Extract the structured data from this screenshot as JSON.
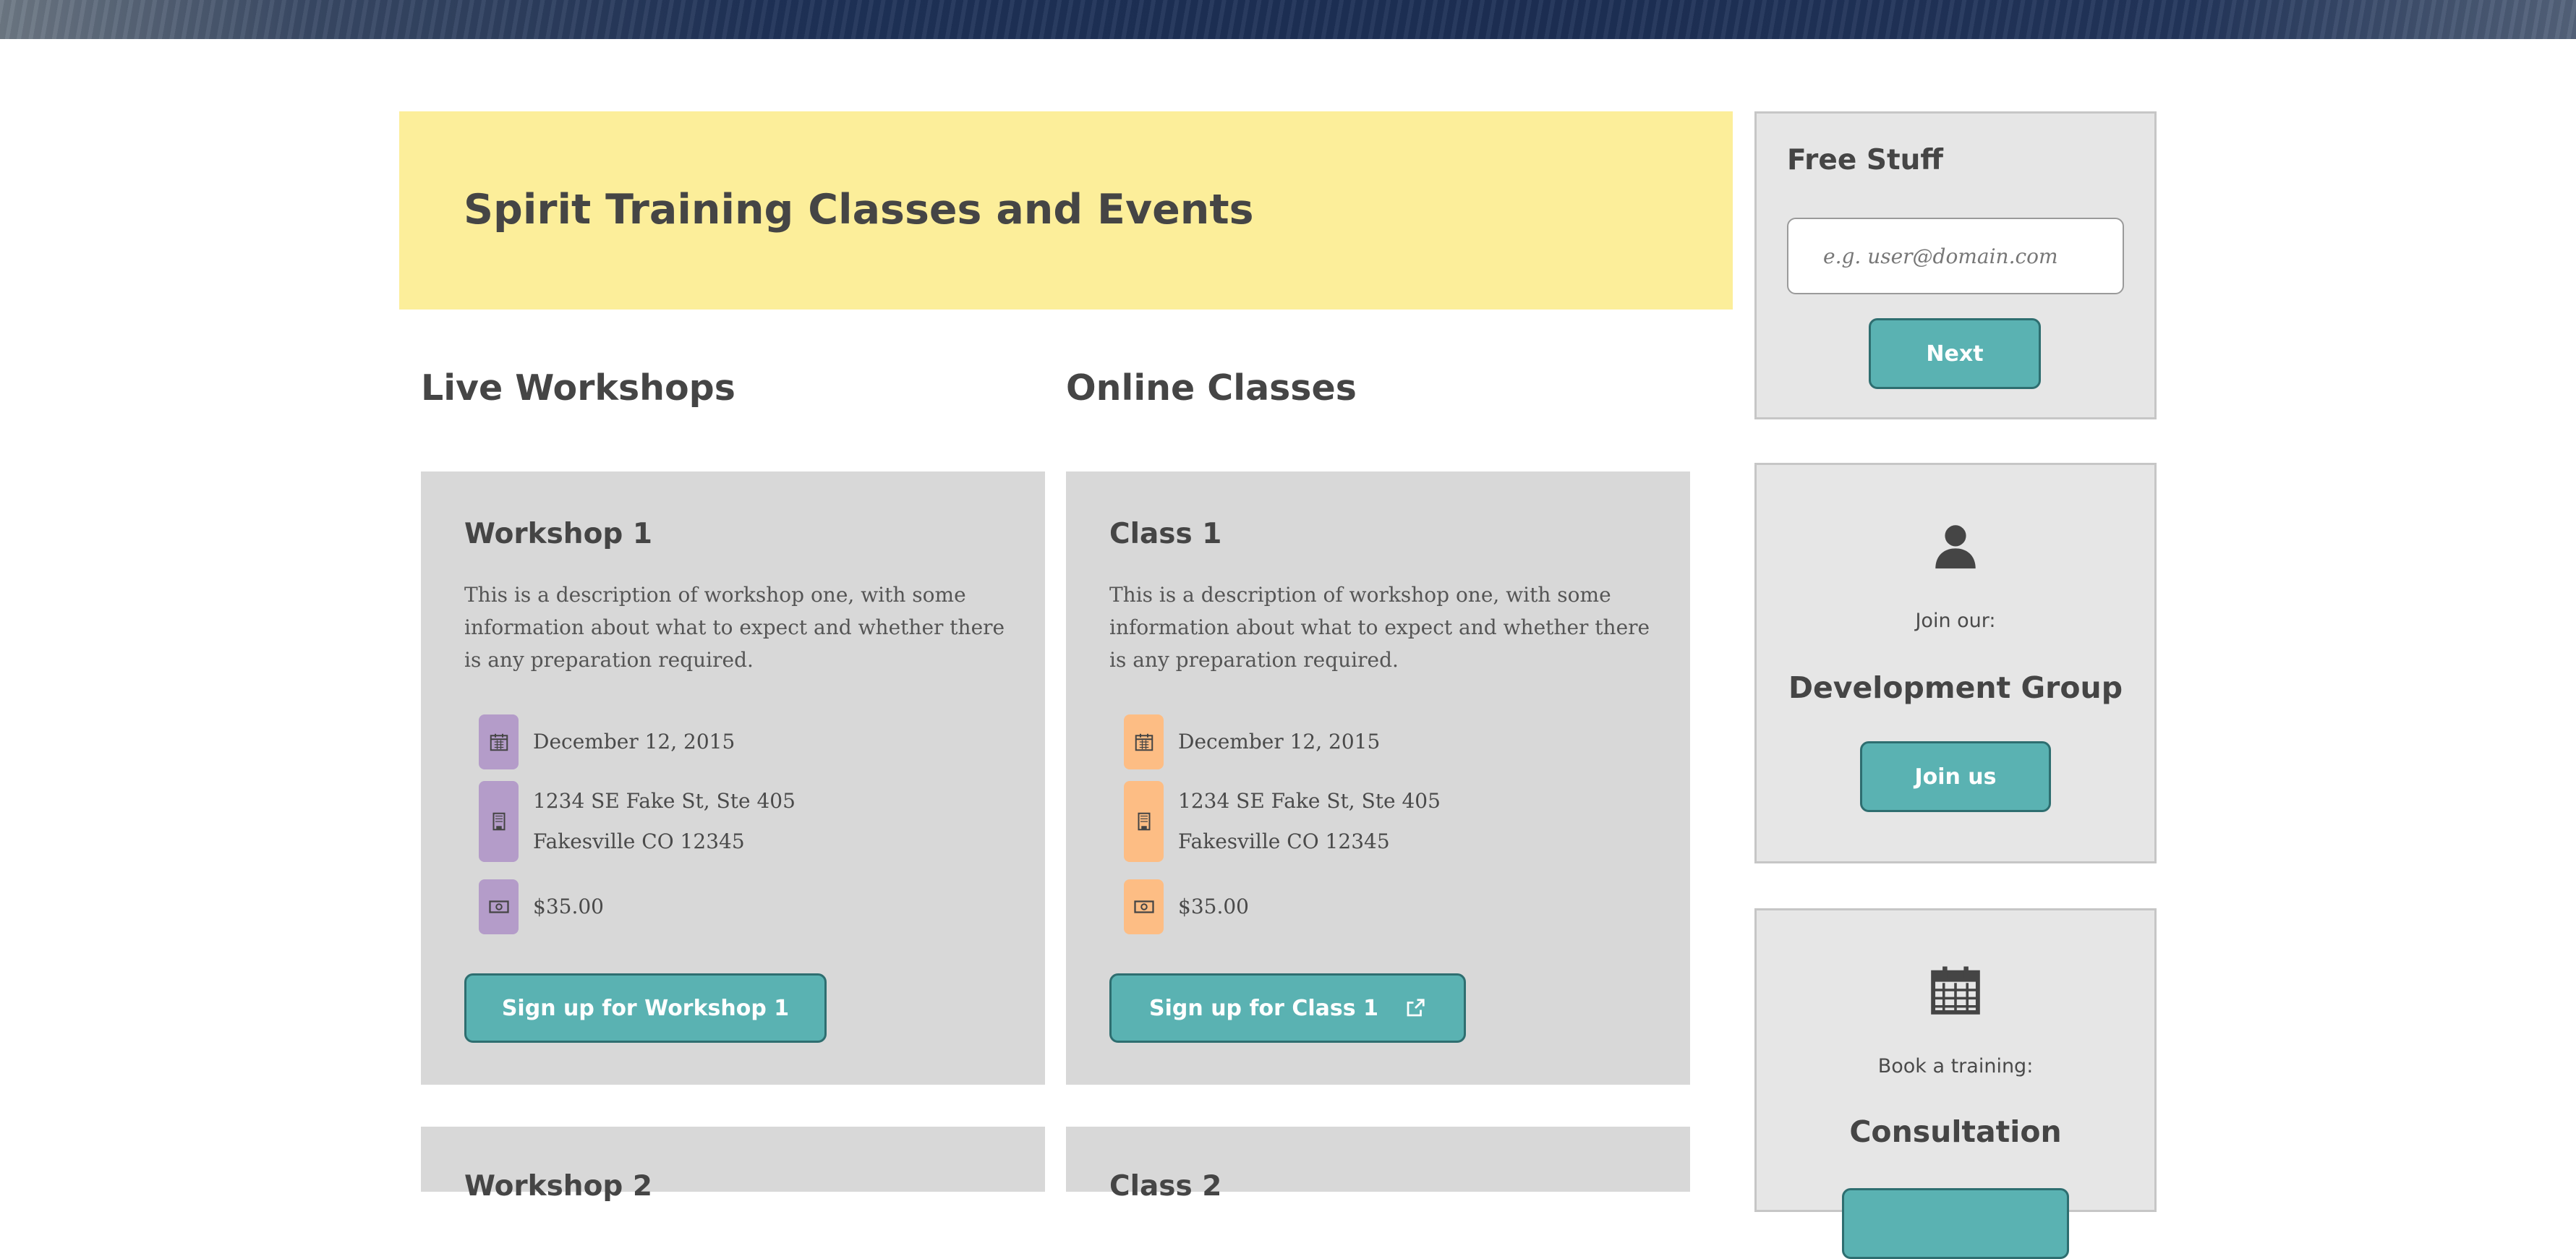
{
  "page": {
    "title": "Spirit Training Classes and Events"
  },
  "columns": {
    "workshops_heading": "Live Workshops",
    "classes_heading": "Online Classes"
  },
  "workshops": [
    {
      "title": "Workshop 1",
      "description": "This is a description of workshop one, with some information about what to expect and whether there is any preparation required.",
      "date": "December 12, 2015",
      "address_line1": "1234 SE Fake St, Ste 405",
      "address_line2": "Fakesville CO 12345",
      "price": "$35.00",
      "cta_label": "Sign up for Workshop 1"
    },
    {
      "title": "Workshop 2"
    }
  ],
  "classes": [
    {
      "title": "Class 1",
      "description": "This is a description of workshop one, with some information about what to expect and whether there is any preparation required.",
      "date": "December 12, 2015",
      "address_line1": "1234 SE Fake St, Ste 405",
      "address_line2": "Fakesville CO 12345",
      "price": "$35.00",
      "cta_label": "Sign up for Class 1"
    },
    {
      "title": "Class 2"
    }
  ],
  "sidebar": {
    "free_stuff": {
      "title": "Free Stuff",
      "email_placeholder": "e.g. user@domain.com",
      "next_label": "Next"
    },
    "group": {
      "icon": "user-icon",
      "intro": "Join our:",
      "name": "Development Group",
      "button_label": "Join us"
    },
    "consultation": {
      "icon": "calendar-icon",
      "intro": "Book a training:",
      "name": "Consultation"
    }
  },
  "colors": {
    "banner": "#fcee9a",
    "card": "#d8d8d8",
    "button": "#5ab2b2",
    "button_border": "#2e6e70",
    "workshop_icon_bg": "#b49cc9",
    "class_icon_bg": "#fdbd84",
    "sidebar_box": "#e6e6e6"
  }
}
